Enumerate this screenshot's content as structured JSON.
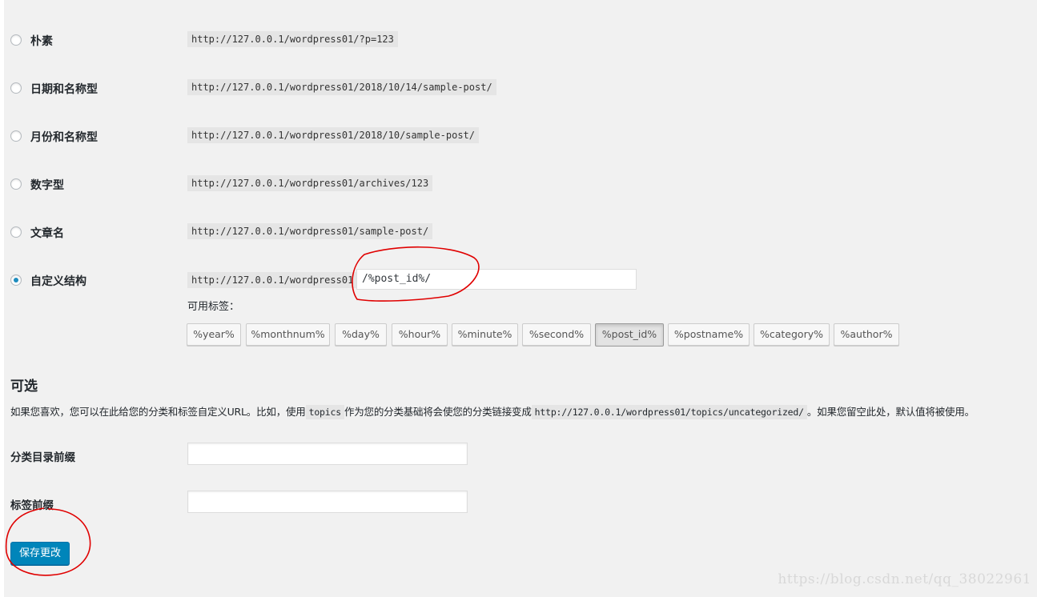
{
  "permalink_options": [
    {
      "label": "朴素",
      "url": "http://127.0.0.1/wordpress01/?p=123",
      "checked": false
    },
    {
      "label": "日期和名称型",
      "url": "http://127.0.0.1/wordpress01/2018/10/14/sample-post/",
      "checked": false
    },
    {
      "label": "月份和名称型",
      "url": "http://127.0.0.1/wordpress01/2018/10/sample-post/",
      "checked": false
    },
    {
      "label": "数字型",
      "url": "http://127.0.0.1/wordpress01/archives/123",
      "checked": false
    },
    {
      "label": "文章名",
      "url": "http://127.0.0.1/wordpress01/sample-post/",
      "checked": false
    },
    {
      "label": "自定义结构",
      "url": "http://127.0.0.1/wordpress01",
      "checked": true
    }
  ],
  "custom_structure": {
    "value": "/%post_id%/"
  },
  "available_tags": {
    "label": "可用标签：",
    "tags": [
      "%year%",
      "%monthnum%",
      "%day%",
      "%hour%",
      "%minute%",
      "%second%",
      "%post_id%",
      "%postname%",
      "%category%",
      "%author%"
    ],
    "active": "%post_id%"
  },
  "optional": {
    "title": "可选",
    "desc_part1": "如果您喜欢，您可以在此给您的分类和标签自定义URL。比如，使用",
    "desc_code1": "topics",
    "desc_part2": "作为您的分类基础将会使您的分类链接变成",
    "desc_code2": "http://127.0.0.1/wordpress01/topics/uncategorized/",
    "desc_part3": "。如果您留空此处，默认值将被使用。",
    "category_base_label": "分类目录前缀",
    "category_base_value": "",
    "tag_base_label": "标签前缀",
    "tag_base_value": ""
  },
  "save_button": "保存更改",
  "watermark": "https://blog.csdn.net/qq_38022961",
  "colors": {
    "accent": "#0085ba",
    "annotation": "#e00000",
    "background": "#f1f1f1"
  }
}
